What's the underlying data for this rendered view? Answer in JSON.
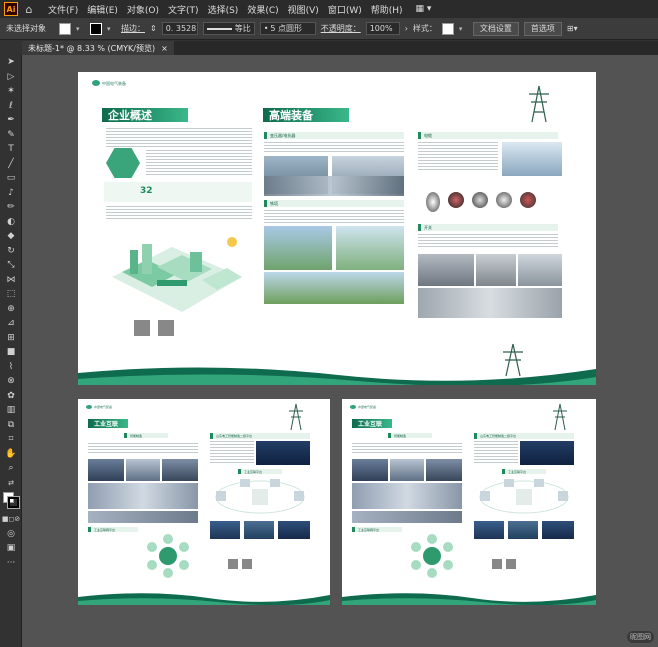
{
  "app": {
    "logo": "Ai",
    "home_icon": "home-icon"
  },
  "menu": [
    "文件(F)",
    "编辑(E)",
    "对象(O)",
    "文字(T)",
    "选择(S)",
    "效果(C)",
    "视图(V)",
    "窗口(W)",
    "帮助(H)"
  ],
  "control": {
    "selection_status": "未选择对象",
    "stroke_label": "描边：",
    "stroke_value": "0. 3528",
    "stroke_style": "等比",
    "brush_label": "5 点圆形",
    "opacity_label": "不透明度：",
    "opacity_value": "100%",
    "style_label": "样式：",
    "doc_setup_btn": "文档设置",
    "prefs_btn": "首选项"
  },
  "document": {
    "tab_title": "未标题-1* @ 8.33 % (CMYK/预览)",
    "close": "×"
  },
  "artboard1": {
    "brand": "中国电气装备",
    "title_left": "企业概述",
    "title_right": "高端装备",
    "sec_transformer": "变压器/电抗器",
    "sec_tower": "铁塔",
    "sec_cable": "电缆",
    "sec_switch": "开关",
    "stat_value": "32"
  },
  "artboard2": {
    "brand": "中国电气装备",
    "title": "工业互联",
    "sec_smart": "智能制造",
    "sec_platform": "山东电工智能制造二级平台",
    "sec_apps": "工业互联平台",
    "sec_twin": "工业互联网平台"
  },
  "artboard3": {
    "brand": "中国电气装备",
    "title": "工业互联",
    "sec_smart": "智能制造",
    "sec_platform": "山东电工智能制造二级平台",
    "sec_apps": "工业互联平台",
    "sec_twin": "工业互联网平台"
  },
  "watermark": "昵图网"
}
